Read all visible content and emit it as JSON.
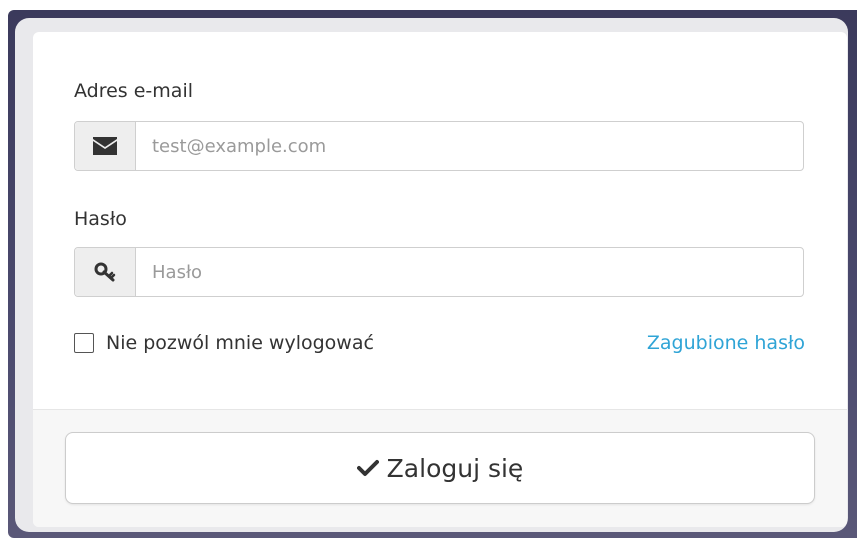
{
  "form": {
    "email_label": "Adres e-mail",
    "email_placeholder": "test@example.com",
    "email_icon": "envelope-icon",
    "password_label": "Hasło",
    "password_placeholder": "Hasło",
    "password_icon": "key-icon",
    "remember_label": "Nie pozwól mnie wylogować",
    "remember_checked": false,
    "lost_password_link": "Zagubione hasło",
    "submit_label": "Zaloguj się",
    "submit_icon": "checkmark-icon"
  },
  "colors": {
    "link": "#2fa4d6",
    "text": "#333333",
    "addon_bg": "#eeeeee",
    "frame": "#3b3a5c"
  }
}
